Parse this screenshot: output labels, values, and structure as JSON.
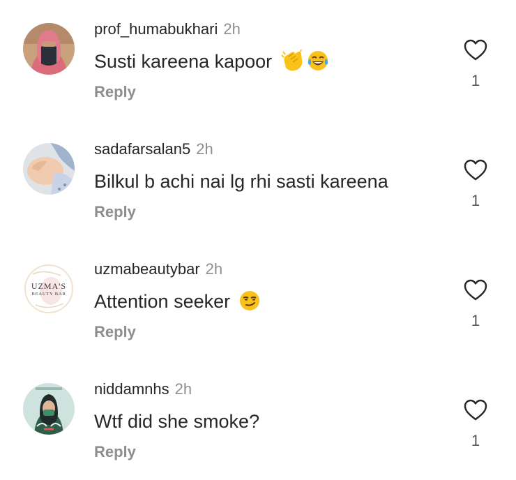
{
  "comments": [
    {
      "username": "prof_humabukhari",
      "time": "2h",
      "text": "Susti kareena kapoor",
      "emojis": [
        "clapping-hands-emoji",
        "tears-of-joy-emoji"
      ],
      "reply_label": "Reply",
      "likes": "1"
    },
    {
      "username": "sadafarsalan5",
      "time": "2h",
      "text": "Bilkul b achi nai lg rhi sasti kareena",
      "reply_label": "Reply",
      "likes": "1"
    },
    {
      "username": "uzmabeautybar",
      "time": "2h",
      "text": "Attention seeker",
      "emojis": [
        "smirking-face-emoji"
      ],
      "reply_label": "Reply",
      "likes": "1",
      "avatar_logo_text": [
        "UZMA'S",
        "BEAUTY BAR"
      ]
    },
    {
      "username": "niddamnhs",
      "time": "2h",
      "text": "Wtf did she smoke?",
      "reply_label": "Reply",
      "likes": "1"
    }
  ],
  "colors": {
    "text": "#262626",
    "secondary": "#8e8e8e",
    "heart_outline": "#262626",
    "emoji_yellow": "#f9c21b"
  }
}
